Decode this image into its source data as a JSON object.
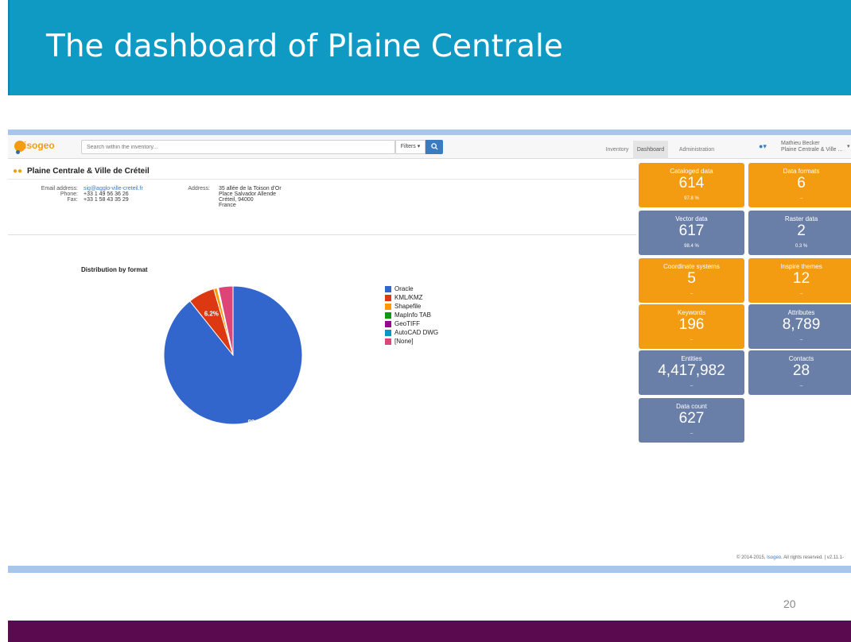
{
  "slide": {
    "title": "The dashboard of Plaine Centrale",
    "page_number": "20",
    "colors": {
      "header": "#0f9ac4",
      "footer": "#5a0b4f"
    }
  },
  "app": {
    "logo": "isogeo",
    "search": {
      "placeholder": "Search within the inventory..."
    },
    "filters_label": "Filters ▾",
    "search_button_icon": "search-icon",
    "nav": [
      "Inventory",
      "Dashboard",
      "Administration"
    ],
    "active_nav": "Dashboard",
    "user": {
      "name": "Mathieu Becker",
      "org": "Plaine Centrale & Ville ..."
    },
    "colors": {
      "accent": "#f39c12",
      "tile_orange": "#f39c12",
      "tile_slate": "#6a7fa8",
      "link": "#3b7bbf"
    }
  },
  "org": {
    "title": "Plaine Centrale & Ville de Créteil",
    "labels": {
      "email": "Email address:",
      "phone": "Phone:",
      "fax": "Fax:",
      "address": "Address:"
    },
    "email": "sig@agglo-ville-creteil.fr",
    "phone": "+33 1 49 56 36 26",
    "fax": "+33 1 58 43 35 29",
    "address": [
      "35 allée de la Toison d'Or",
      "Place Salvador Allende",
      "Créteil, 94000",
      "France"
    ]
  },
  "chart_data": {
    "type": "pie",
    "title": "Distribution by format",
    "categories": [
      "Oracle",
      "KML/KMZ",
      "Shapefile",
      "MapInfo TAB",
      "GeoTIFF",
      "AutoCAD DWG",
      "[None]"
    ],
    "values": [
      89.3,
      6.2,
      0.8,
      0.1,
      0.1,
      0.1,
      3.4
    ],
    "colors": [
      "#3366cc",
      "#dc3912",
      "#ff9900",
      "#109618",
      "#990099",
      "#0099c6",
      "#dd4477"
    ],
    "data_labels": [
      "89.3%",
      "6.2%",
      "",
      "",
      "",
      "",
      ""
    ],
    "legend_position": "right"
  },
  "tiles": [
    {
      "label": "Cataloged data",
      "value": "614",
      "sub": "97.8 %",
      "color": "orange"
    },
    {
      "label": "Data formats",
      "value": "6",
      "sub": "–",
      "color": "orange"
    },
    {
      "label": "Vector data",
      "value": "617",
      "sub": "98.4 %",
      "color": "slate"
    },
    {
      "label": "Raster data",
      "value": "2",
      "sub": "0.3 %",
      "color": "slate"
    },
    {
      "label": "Coordinate systems",
      "value": "5",
      "sub": "–",
      "color": "orange"
    },
    {
      "label": "Inspire themes",
      "value": "12",
      "sub": "–",
      "color": "orange"
    },
    {
      "label": "Keywords",
      "value": "196",
      "sub": "–",
      "color": "orange"
    },
    {
      "label": "Attributes",
      "value": "8,789",
      "sub": "–",
      "color": "slate"
    },
    {
      "label": "Entities",
      "value": "4,417,982",
      "sub": "–",
      "color": "slate"
    },
    {
      "label": "Contacts",
      "value": "28",
      "sub": "–",
      "color": "slate"
    },
    {
      "label": "Data count",
      "value": "627",
      "sub": "–",
      "color": "slate"
    }
  ],
  "footer": {
    "copyright_pre": "© 2014-2015,",
    "copyright_link": "Isogeo",
    "copyright_post": ". All rights reserved. | v2.11.1-"
  }
}
